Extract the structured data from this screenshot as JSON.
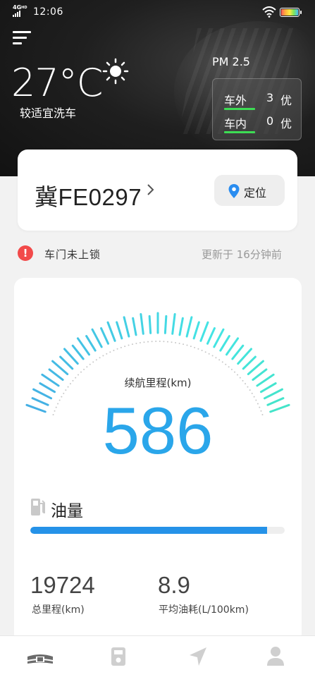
{
  "status_bar": {
    "network": "4G",
    "network_sup": "HD",
    "time": "12:06"
  },
  "weather": {
    "temperature": "27°C",
    "wash_advice": "较适宜洗车"
  },
  "pm25": {
    "title": "PM 2.5",
    "rows": [
      {
        "label": "车外",
        "value": "3",
        "level": "优"
      },
      {
        "label": "车内",
        "value": "0",
        "level": "优"
      }
    ],
    "good_color": "#3ddc54"
  },
  "vehicle": {
    "plate": "冀FE0297",
    "locate_label": "定位"
  },
  "alert": {
    "message": "车门未上锁",
    "updated": "更新于 16分钟前",
    "color": "#f24a4a"
  },
  "range": {
    "label": "续航里程(km)",
    "value": "586",
    "color": "#2aa6ea"
  },
  "fuel": {
    "label": "油量",
    "level_percent": 93,
    "bar_color": "#2592e8"
  },
  "stats": [
    {
      "value": "19724",
      "label": "总里程(km)"
    },
    {
      "value": "8.9",
      "label": "平均油耗(L/100km)"
    }
  ],
  "tabs": [
    {
      "icon": "car-front-icon",
      "active": true
    },
    {
      "icon": "device-icon",
      "active": false
    },
    {
      "icon": "navigation-icon",
      "active": false
    },
    {
      "icon": "user-icon",
      "active": false
    }
  ]
}
